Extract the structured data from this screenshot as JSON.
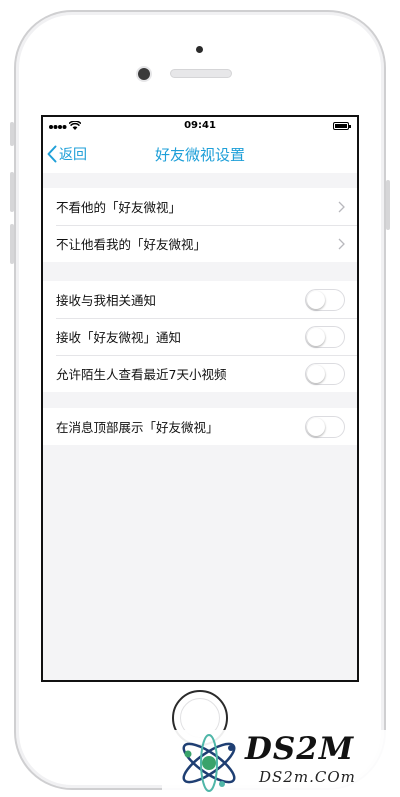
{
  "status_bar": {
    "time": "09:41"
  },
  "nav": {
    "back_label": "返回",
    "title": "好友微视设置"
  },
  "groups": [
    {
      "rows": [
        {
          "label": "不看他的「好友微视」",
          "control": "chevron"
        },
        {
          "label": "不让他看我的「好友微视」",
          "control": "chevron"
        }
      ]
    },
    {
      "rows": [
        {
          "label": "接收与我相关通知",
          "control": "toggle",
          "on": false
        },
        {
          "label": "接收「好友微视」通知",
          "control": "toggle",
          "on": false
        },
        {
          "label": "允许陌生人查看最近7天小视频",
          "control": "toggle",
          "on": false
        }
      ]
    },
    {
      "rows": [
        {
          "label": "在消息顶部展示「好友微视」",
          "control": "toggle",
          "on": false
        }
      ]
    }
  ],
  "watermark": {
    "brand": "DS2M",
    "domain": "DS2m.COm"
  },
  "colors": {
    "accent": "#1e9fd8",
    "background": "#f4f4f6"
  },
  "icons": [
    "signal-icon",
    "wifi-icon",
    "battery-icon",
    "back-chevron-icon",
    "chevron-right-icon",
    "atom-logo-icon"
  ]
}
